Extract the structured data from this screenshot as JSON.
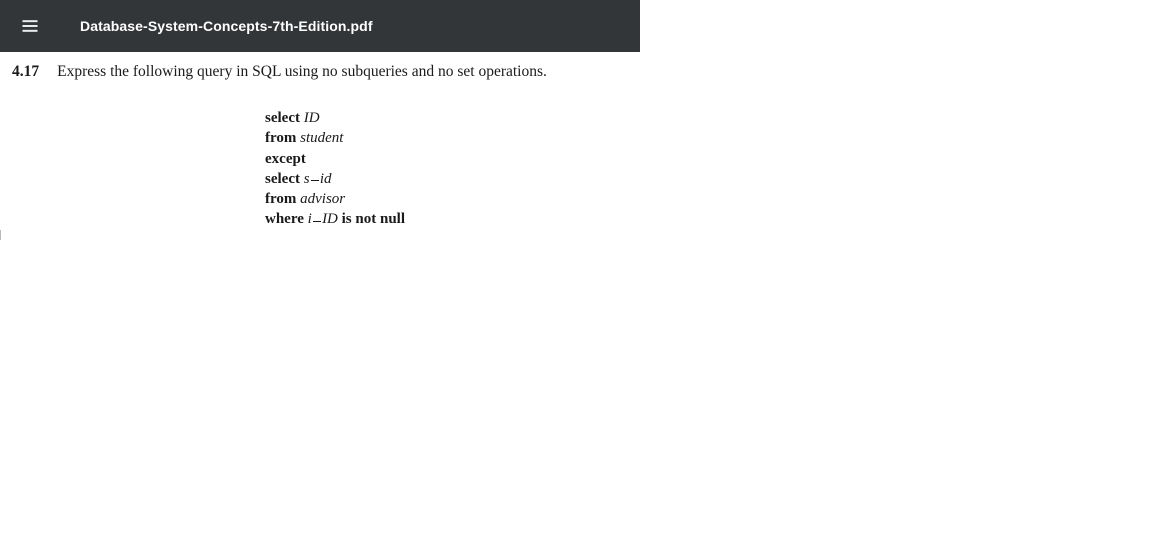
{
  "toolbar": {
    "title": "Database-System-Concepts-7th-Edition.pdf"
  },
  "problem": {
    "number": "4.17",
    "prompt": "Express the following query in SQL using no subqueries and no set operations."
  },
  "code": {
    "line1_kw": "select",
    "line1_id": "ID",
    "line2_kw": "from",
    "line2_id": "student",
    "line3_kw": "except",
    "line4_kw": "select",
    "line4_id_a": "s",
    "line4_id_b": "id",
    "line5_kw": "from",
    "line5_id": "advisor",
    "line6_kw": "where",
    "line6_id_a": "i",
    "line6_id_b": "ID",
    "line6_tail": "is not null"
  }
}
